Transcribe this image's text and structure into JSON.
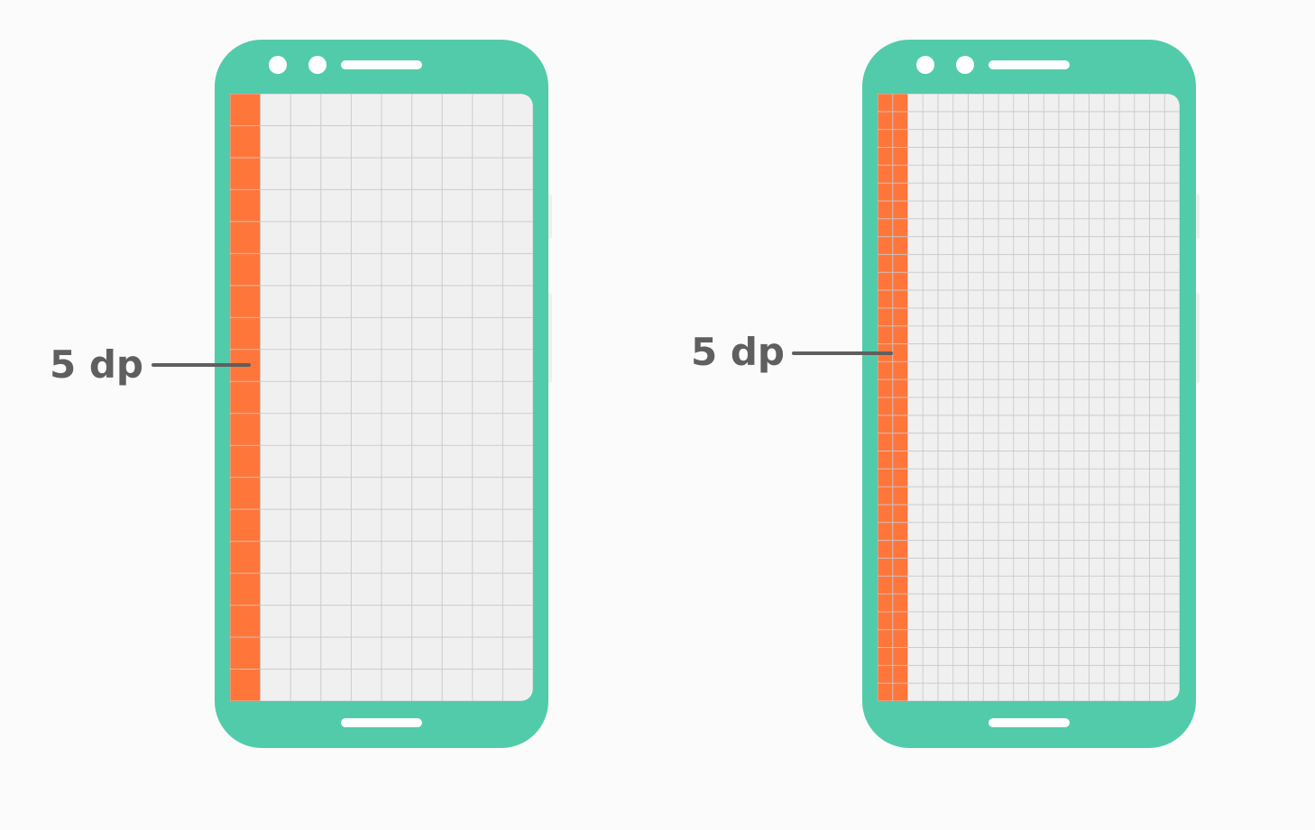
{
  "colors": {
    "background": "#fbfbfb",
    "phone_body": "#52cbaa",
    "screen": "#f0f0f0",
    "grid_line": "#c9c9c9",
    "highlight_column": "#ff763b",
    "label_text": "#5f5f5f",
    "pointer_line": "#5f5f5f"
  },
  "phones": [
    {
      "id": "phone-left",
      "grid_columns": 10,
      "grid_rows": 19,
      "highlighted_columns": 1,
      "label": "5 dp"
    },
    {
      "id": "phone-right",
      "grid_columns": 20,
      "grid_rows": 34,
      "highlighted_columns": 2,
      "label": "5 dp"
    }
  ]
}
